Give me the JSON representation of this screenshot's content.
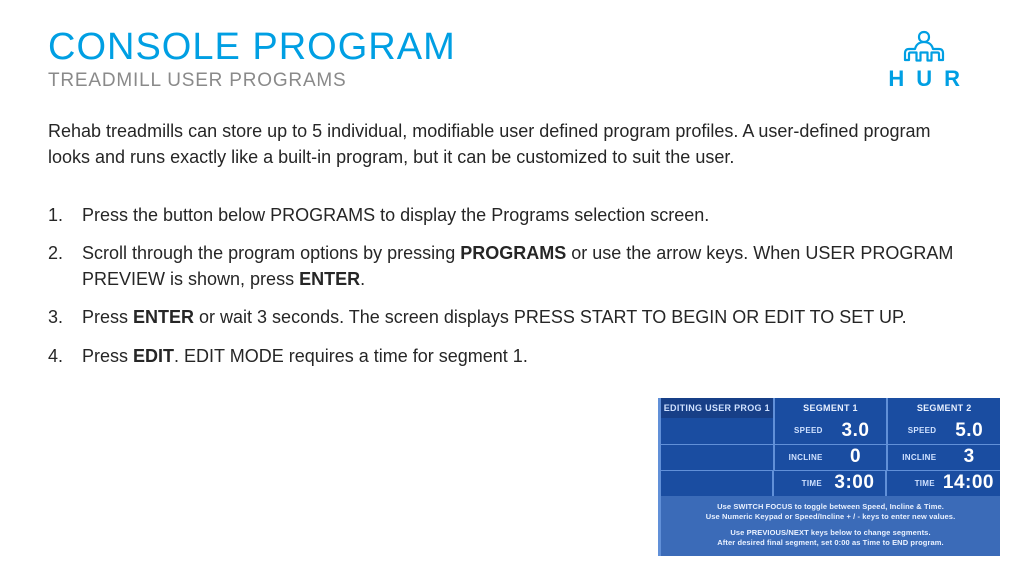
{
  "header": {
    "title": "CONSOLE PROGRAM",
    "subtitle": "TREADMILL USER PROGRAMS",
    "logo_text": "HUR"
  },
  "intro": "Rehab treadmills can store up to 5 individual, modifiable user defined program profiles. A user-defined program looks and runs exactly like a built-in program, but it can be customized to suit the user.",
  "steps": {
    "s1": "Press the button below PROGRAMS to display the Programs selection screen.",
    "s2a": "Scroll through the program options by pressing ",
    "s2b": "PROGRAMS",
    "s2c": " or use the arrow keys. When USER PROGRAM PREVIEW is shown, press ",
    "s2d": "ENTER",
    "s2e": ".",
    "s3a": "Press ",
    "s3b": "ENTER",
    "s3c": " or wait 3 seconds. The screen displays PRESS START TO BEGIN OR EDIT TO SET UP.",
    "s4a": "Press ",
    "s4b": "EDIT",
    "s4c": ". EDIT MODE requires a time for segment 1."
  },
  "panel": {
    "edit_label": "EDITING USER PROG 1",
    "seg1_label": "SEGMENT 1",
    "seg2_label": "SEGMENT 2",
    "row_speed": "SPEED",
    "row_incline": "INCLINE",
    "row_time": "TIME",
    "seg1": {
      "speed": "3.0",
      "incline": "0",
      "time": "3:00"
    },
    "seg2": {
      "speed": "5.0",
      "incline": "3",
      "time": "14:00"
    },
    "foot1": "Use SWITCH FOCUS to toggle between Speed, Incline & Time.",
    "foot2": "Use Numeric Keypad or Speed/Incline + / - keys to enter new values.",
    "foot3": "Use PREVIOUS/NEXT keys below to change segments.",
    "foot4": "After desired final segment, set 0:00 as Time to END program."
  },
  "colors": {
    "accent": "#009fe3",
    "panel_bg": "#1a4da1"
  }
}
